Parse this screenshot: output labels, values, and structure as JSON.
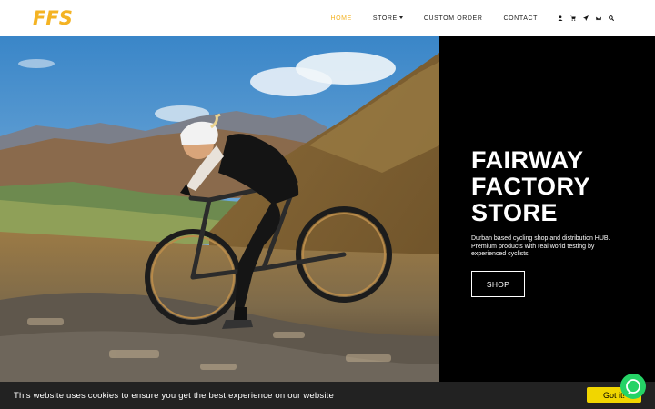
{
  "header": {
    "logo": "FFS",
    "nav": [
      {
        "label": "HOME",
        "active": true
      },
      {
        "label": "STORE",
        "dropdown": true
      },
      {
        "label": "CUSTOM ORDER"
      },
      {
        "label": "CONTACT"
      }
    ],
    "icons": [
      "user-icon",
      "cart-icon",
      "send-icon",
      "envelope-icon",
      "search-icon"
    ]
  },
  "hero": {
    "title_lines": [
      "FAIRWAY",
      "FACTORY",
      "STORE"
    ],
    "description": "Durban based cycling shop and distribution HUB. Premium products with real world testing by experienced cyclists.",
    "button_label": "SHOP",
    "photo_icon": "cyclist-gravel-bike-photo"
  },
  "cookie": {
    "text": "This website uses cookies to ensure you get the best experience on our website",
    "button_label": "Got it!"
  },
  "chat": {
    "icon": "whatsapp-icon"
  },
  "colors": {
    "accent": "#f4b323",
    "panel": "#000000",
    "cookie_bg": "#222222",
    "cookie_btn": "#f1d600",
    "chat": "#25d366"
  }
}
